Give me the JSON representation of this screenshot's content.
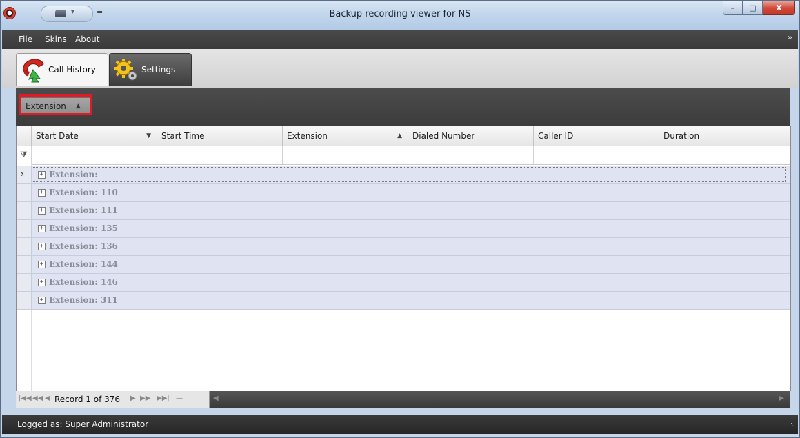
{
  "window": {
    "title": "Backup recording viewer for NS",
    "qat_customize": "≡",
    "buttons": {
      "minimize": "–",
      "maximize": "□",
      "close": "X"
    }
  },
  "menu": {
    "items": [
      "File",
      "Skins",
      "About"
    ],
    "collapse": "»"
  },
  "tabs": [
    {
      "label": "Call History",
      "icon": "phone-icon",
      "active": true
    },
    {
      "label": "Settings",
      "icon": "gears-icon",
      "active": false
    }
  ],
  "group_panel": {
    "chip_label": "Extension",
    "chip_sort": "▲"
  },
  "grid": {
    "columns": [
      {
        "label": "Start Date",
        "sort": "▼"
      },
      {
        "label": "Start Time",
        "sort": ""
      },
      {
        "label": "Extension",
        "sort": "▲"
      },
      {
        "label": "Dialed Number",
        "sort": ""
      },
      {
        "label": "Caller ID",
        "sort": ""
      },
      {
        "label": "Duration",
        "sort": ""
      }
    ],
    "filter_icon": "⧩",
    "group_rows": [
      "Extension:",
      "Extension: 110",
      "Extension: 111",
      "Extension: 135",
      "Extension: 136",
      "Extension: 144",
      "Extension: 146",
      "Extension: 311"
    ],
    "expander": "+",
    "current_row_marker": "›"
  },
  "navigator": {
    "first": "|◀◀",
    "prev_page": "◀◀",
    "prev": "◀",
    "record_text": "Record 1 of 376",
    "next": "▶",
    "next_page": "▶▶",
    "last": "▶▶|",
    "delete": "—"
  },
  "status": {
    "text": "Logged as: Super Administrator",
    "grip": "∴"
  }
}
